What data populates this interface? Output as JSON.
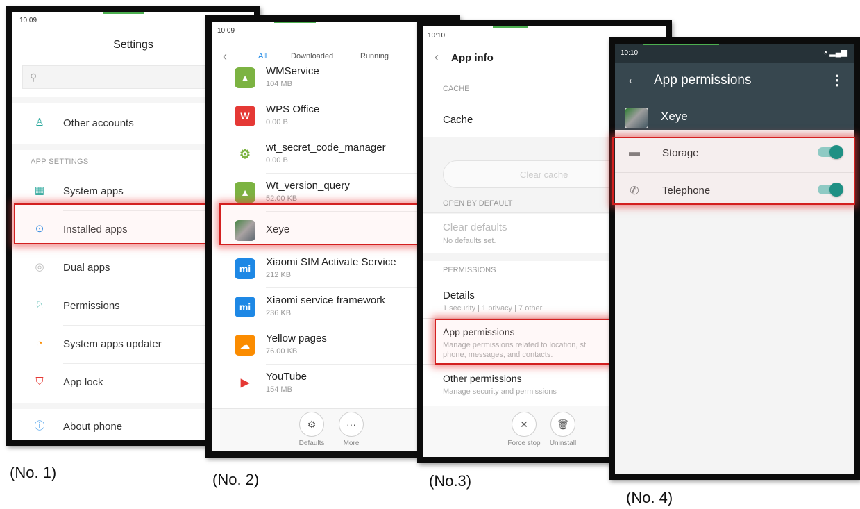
{
  "phone1": {
    "status_time": "10:09",
    "title": "Settings",
    "search_icon": "search-icon",
    "items": [
      {
        "label": "Other accounts",
        "icon": "person-icon"
      },
      {
        "label": "System apps",
        "icon": "grid-icon"
      },
      {
        "label": "Installed apps",
        "icon": "ellipsis-circle-icon"
      },
      {
        "label": "Dual apps",
        "icon": "dual-circle-icon"
      },
      {
        "label": "Permissions",
        "icon": "shield-person-icon"
      },
      {
        "label": "System apps updater",
        "icon": "update-icon"
      },
      {
        "label": "App lock",
        "icon": "lock-shield-icon"
      },
      {
        "label": "About phone",
        "icon": "info-icon"
      }
    ],
    "section_app_settings": "APP SETTINGS",
    "caption": "(No. 1)"
  },
  "phone2": {
    "status_time": "10:09",
    "tabs": [
      "All",
      "Downloaded",
      "Running"
    ],
    "apps": [
      {
        "name": "WMService",
        "size": "104 MB",
        "icon": "android-icon",
        "color": "#7cb342"
      },
      {
        "name": "WPS Office",
        "size": "0.00 B",
        "icon": "wps-icon",
        "color": "#e53935"
      },
      {
        "name": "wt_secret_code_manager",
        "size": "0.00 B",
        "icon": "gear-android-icon",
        "color": "#7cb342"
      },
      {
        "name": "Wt_version_query",
        "size": "52.00 KB",
        "icon": "android-icon",
        "color": "#7cb342"
      },
      {
        "name": "Xeye",
        "size": "",
        "icon": "xeye-app-icon",
        "color": "#455a64"
      },
      {
        "name": "Xiaomi SIM Activate Service",
        "size": "212 KB",
        "icon": "mi-icon",
        "color": "#1e88e5"
      },
      {
        "name": "Xiaomi service framework",
        "size": "236 KB",
        "icon": "mi-icon",
        "color": "#1e88e5"
      },
      {
        "name": "Yellow pages",
        "size": "76.00 KB",
        "icon": "cloud-icon",
        "color": "#fb8c00"
      },
      {
        "name": "YouTube",
        "size": "154 MB",
        "icon": "youtube-icon",
        "color": "#e53935"
      }
    ],
    "defaults_label": "Defaults",
    "more_label": "More",
    "caption": "(No. 2)"
  },
  "phone3": {
    "status_time": "10:10",
    "title": "App info",
    "cache_header": "CACHE",
    "cache_label": "Cache",
    "clear_cache": "Clear cache",
    "open_by_default_header": "OPEN BY DEFAULT",
    "clear_defaults": "Clear defaults",
    "no_defaults": "No defaults set.",
    "permissions_header": "PERMISSIONS",
    "details_label": "Details",
    "details_sub": "1 security | 1 privacy | 7 other",
    "app_permissions_label": "App permissions",
    "app_permissions_sub1": "Manage permissions related to location, st",
    "app_permissions_sub2": "phone, messages, and contacts.",
    "other_permissions_label": "Other permissions",
    "other_permissions_sub": "Manage security and permissions",
    "force_stop": "Force stop",
    "uninstall": "Uninstall",
    "caption": "(No.3)"
  },
  "phone4": {
    "status_time": "10:10",
    "title": "App permissions",
    "app_name": "Xeye",
    "permissions": [
      {
        "label": "Storage",
        "icon": "folder-icon",
        "enabled": true
      },
      {
        "label": "Telephone",
        "icon": "phone-icon",
        "enabled": true
      }
    ],
    "caption": "(No. 4)"
  }
}
